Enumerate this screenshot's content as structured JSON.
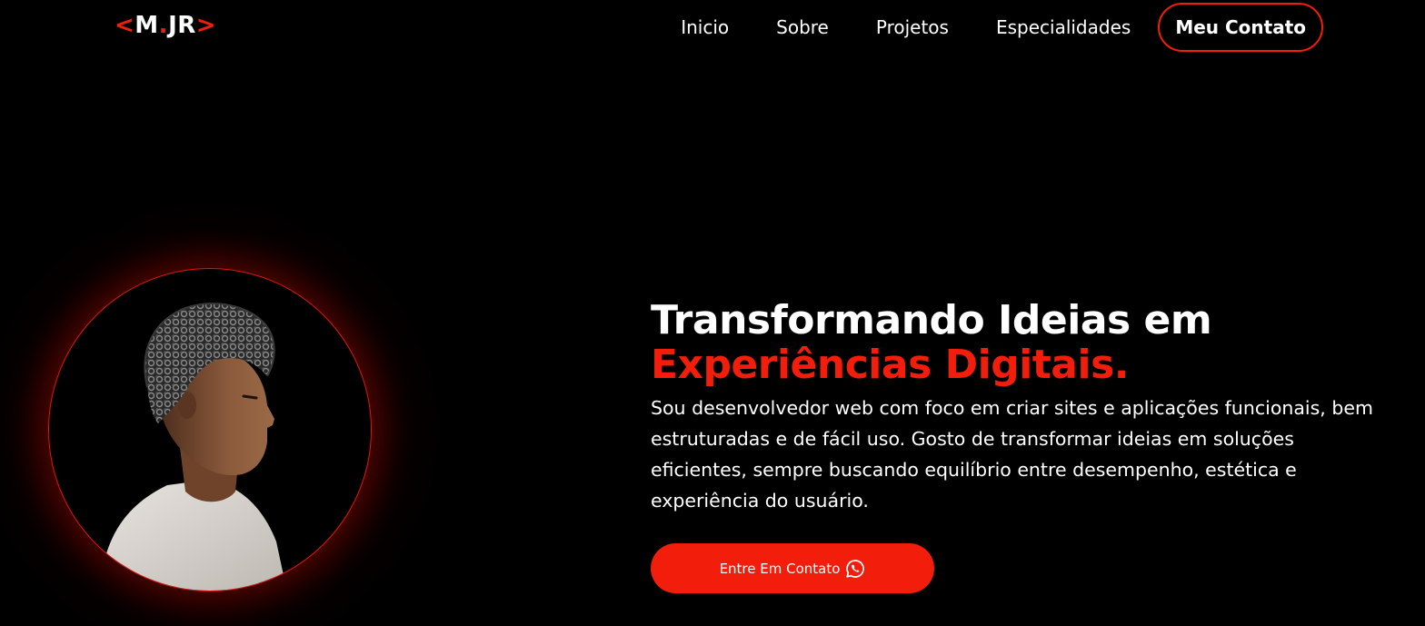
{
  "header": {
    "logo": {
      "open_bracket": "<",
      "initial": "M",
      "dot": ".",
      "suffix": "JR",
      "close_bracket": ">"
    },
    "nav": {
      "items": [
        {
          "label": "Inicio"
        },
        {
          "label": "Sobre"
        },
        {
          "label": "Projetos"
        },
        {
          "label": "Especialidades"
        }
      ],
      "contact_label": "Meu Contato"
    }
  },
  "hero": {
    "title_line1": "Transformando Ideias em",
    "title_line2": "Experiências Digitais.",
    "description": "Sou desenvolvedor web com foco em criar sites e aplicações funcionais, bem estruturadas e de fácil uso. Gosto de transformar ideias em soluções eficientes, sempre buscando equilíbrio entre desempenho, estética e experiência do usuário.",
    "cta_label": "Entre Em Contato",
    "cta_icon": "whatsapp-icon"
  },
  "portrait": {
    "icon": "profile-photo"
  },
  "colors": {
    "accent": "#f21d0a",
    "background": "#000000",
    "text": "#ffffff"
  }
}
